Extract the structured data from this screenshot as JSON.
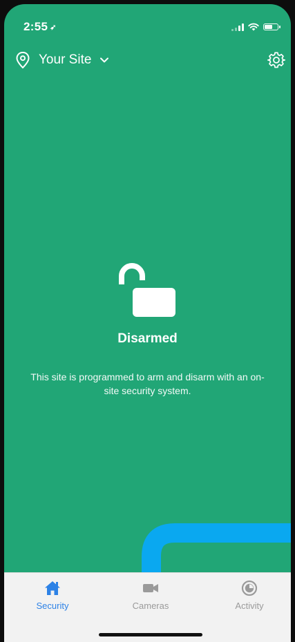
{
  "status_bar": {
    "time": "2:55",
    "location_icon": "location-arrow-icon"
  },
  "header": {
    "site_name": "Your Site",
    "pin_icon": "map-pin-icon",
    "chevron_icon": "chevron-down-icon",
    "settings_icon": "gear-icon"
  },
  "security": {
    "status": "Disarmed",
    "lock_icon": "unlocked-padlock-icon",
    "description": "This site is programmed to arm and disarm with an on-site security system."
  },
  "tabs": [
    {
      "label": "Security",
      "icon": "home-icon",
      "active": true
    },
    {
      "label": "Cameras",
      "icon": "video-camera-icon",
      "active": false
    },
    {
      "label": "Activity",
      "icon": "activity-dial-icon",
      "active": false
    }
  ],
  "colors": {
    "background": "#21a676",
    "active_tab": "#2d82e6",
    "inactive_tab": "#9a9a9a",
    "overlay_stroke": "#0aa8f0",
    "tab_bar": "#f2f2f2"
  }
}
